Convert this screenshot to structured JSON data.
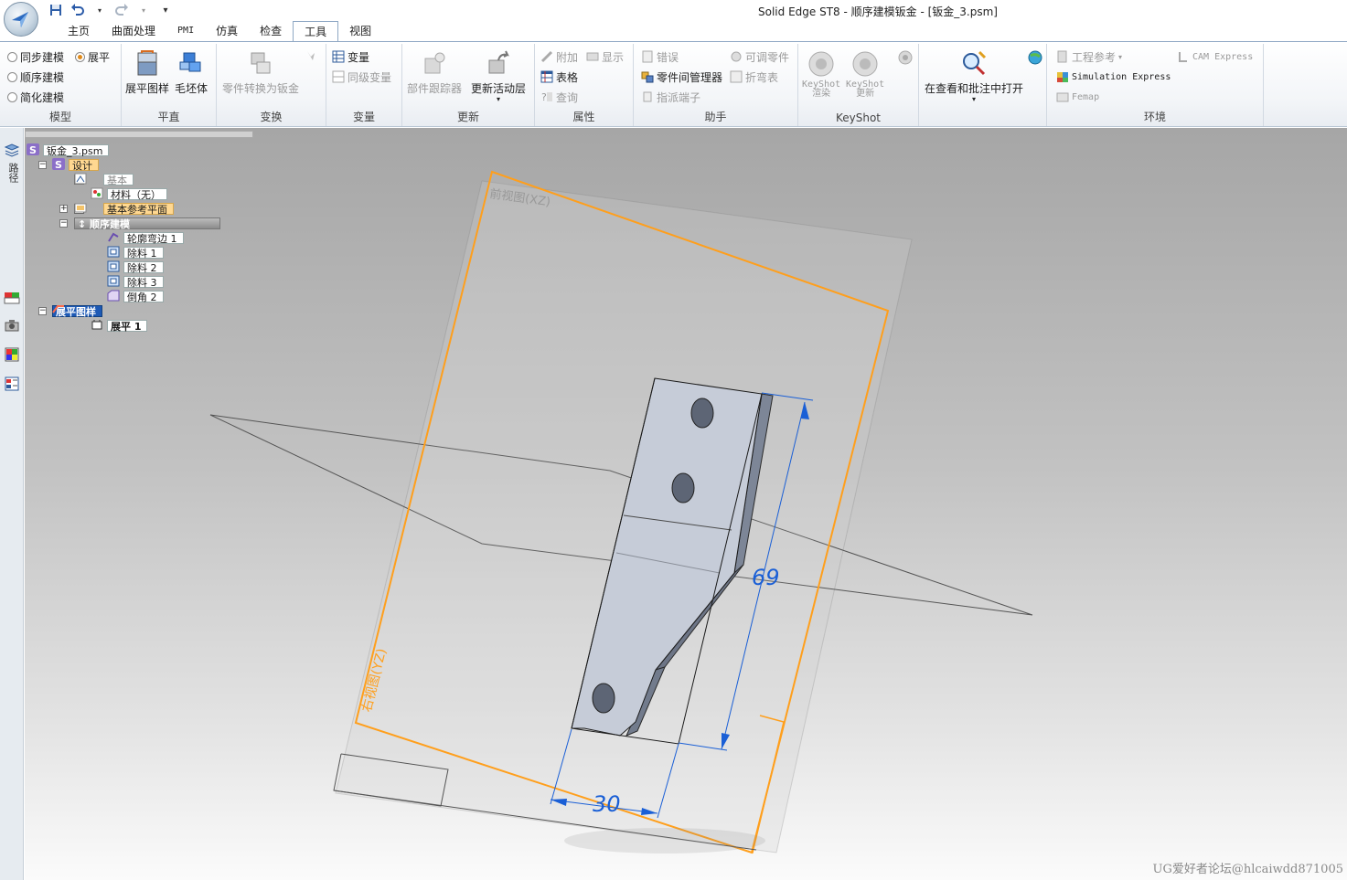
{
  "window": {
    "title": "Solid Edge ST8 - 顺序建模钣金 - [钣金_3.psm]"
  },
  "quick_access": {
    "save_icon": "save-icon",
    "undo_icon": "undo-icon",
    "redo_icon": "redo-icon",
    "customize_icon": "customize-icon"
  },
  "tabs": [
    "主页",
    "曲面处理",
    "PMI",
    "仿真",
    "检查",
    "工具",
    "视图"
  ],
  "active_tab": "工具",
  "ribbon": {
    "model": {
      "label": "模型",
      "options": [
        {
          "label": "同步建模",
          "selected": false
        },
        {
          "label": "展平",
          "selected": true
        },
        {
          "label": "顺序建模",
          "selected": false
        },
        {
          "label": "简化建模",
          "selected": false
        }
      ]
    },
    "flat": {
      "label": "平直",
      "flat_pattern": "展平图样",
      "blank": "毛坯体"
    },
    "transform": {
      "label": "变换",
      "part_to_sheetmetal": "零件转换为钣金"
    },
    "variables": {
      "label": "变量",
      "variables": "变量",
      "peer_variables": "同级变量"
    },
    "update": {
      "label": "更新",
      "part_tracker": "部件跟踪器",
      "update_active_level": "更新活动层"
    },
    "properties": {
      "label": "属性",
      "attach": "附加",
      "show": "显示",
      "table": "表格",
      "query": "查询"
    },
    "assistant": {
      "label": "助手",
      "errors": "错误",
      "adjustable_part": "可调零件",
      "inter_part_manager": "零件间管理器",
      "bend_table": "折弯表",
      "assign_terminal": "指派端子"
    },
    "keyshot": {
      "label": "KeyShot",
      "render_top": "KeyShot",
      "render_bottom": "渲染",
      "update_top": "KeyShot",
      "update_bottom": "更新"
    },
    "review": {
      "open_in_review": "在查看和批注中打开"
    },
    "environment": {
      "label": "环境",
      "engineering_reference": "工程参考",
      "cam_express": "CAM Express",
      "simulation_express": "Simulation Express",
      "femap": "Femap"
    }
  },
  "leftstrip": {
    "label": "路径"
  },
  "tree": {
    "root": "钣金_3.psm",
    "design": "设计",
    "base": "基本",
    "material": "材料（无）",
    "base_planes": "基本参考平面",
    "ordered": "顺序建模",
    "features": [
      "轮廓弯边 1",
      "除料 1",
      "除料 2",
      "除料 3",
      "倒角 2"
    ],
    "flat_pattern": "展平图样",
    "flatten": "展平 1"
  },
  "viewport": {
    "plane_front_label": "前视图(XZ)",
    "plane_right_label": "右视图(YZ)",
    "dimension_height": "69",
    "dimension_width": "30",
    "plane_color": "#ff9f1c",
    "dimension_color": "#1a5fd6"
  },
  "watermark": "UG爱好者论坛@hlcaiwdd871005"
}
